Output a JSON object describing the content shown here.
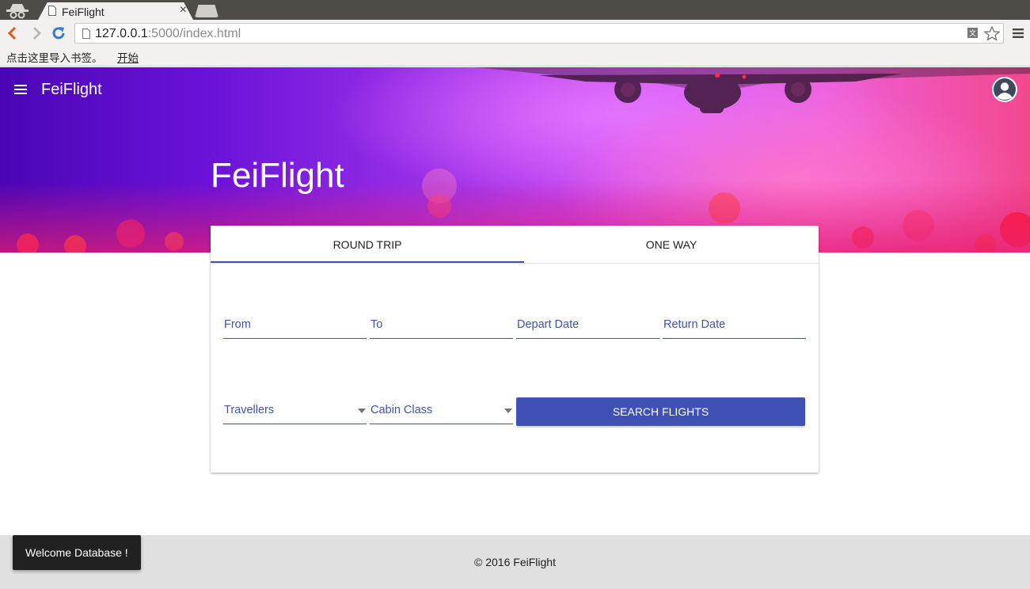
{
  "browser": {
    "tab_title": "FeiFlight",
    "tab_close": "×",
    "url_host": "127.0.0.1",
    "url_rest": ":5000/index.html",
    "bookmarks_prompt": "点击这里导入书签。",
    "bookmarks_link": "开始"
  },
  "app": {
    "brand": "FeiFlight",
    "hero_title": "FeiFlight"
  },
  "search": {
    "tabs": [
      {
        "label": "ROUND TRIP",
        "active": true
      },
      {
        "label": "ONE WAY",
        "active": false
      }
    ],
    "fields": {
      "from": "From",
      "to": "To",
      "depart": "Depart Date",
      "return": "Return Date",
      "travellers": "Travellers",
      "cabin": "Cabin Class"
    },
    "submit_label": "SEARCH FLIGHTS"
  },
  "footer": {
    "copyright": "© 2016 FeiFlight"
  },
  "snackbar": {
    "message": "Welcome Database !"
  },
  "colors": {
    "primary": "#3f51b5",
    "footer_bg": "#e0e0e0",
    "snackbar_bg": "#212121"
  }
}
